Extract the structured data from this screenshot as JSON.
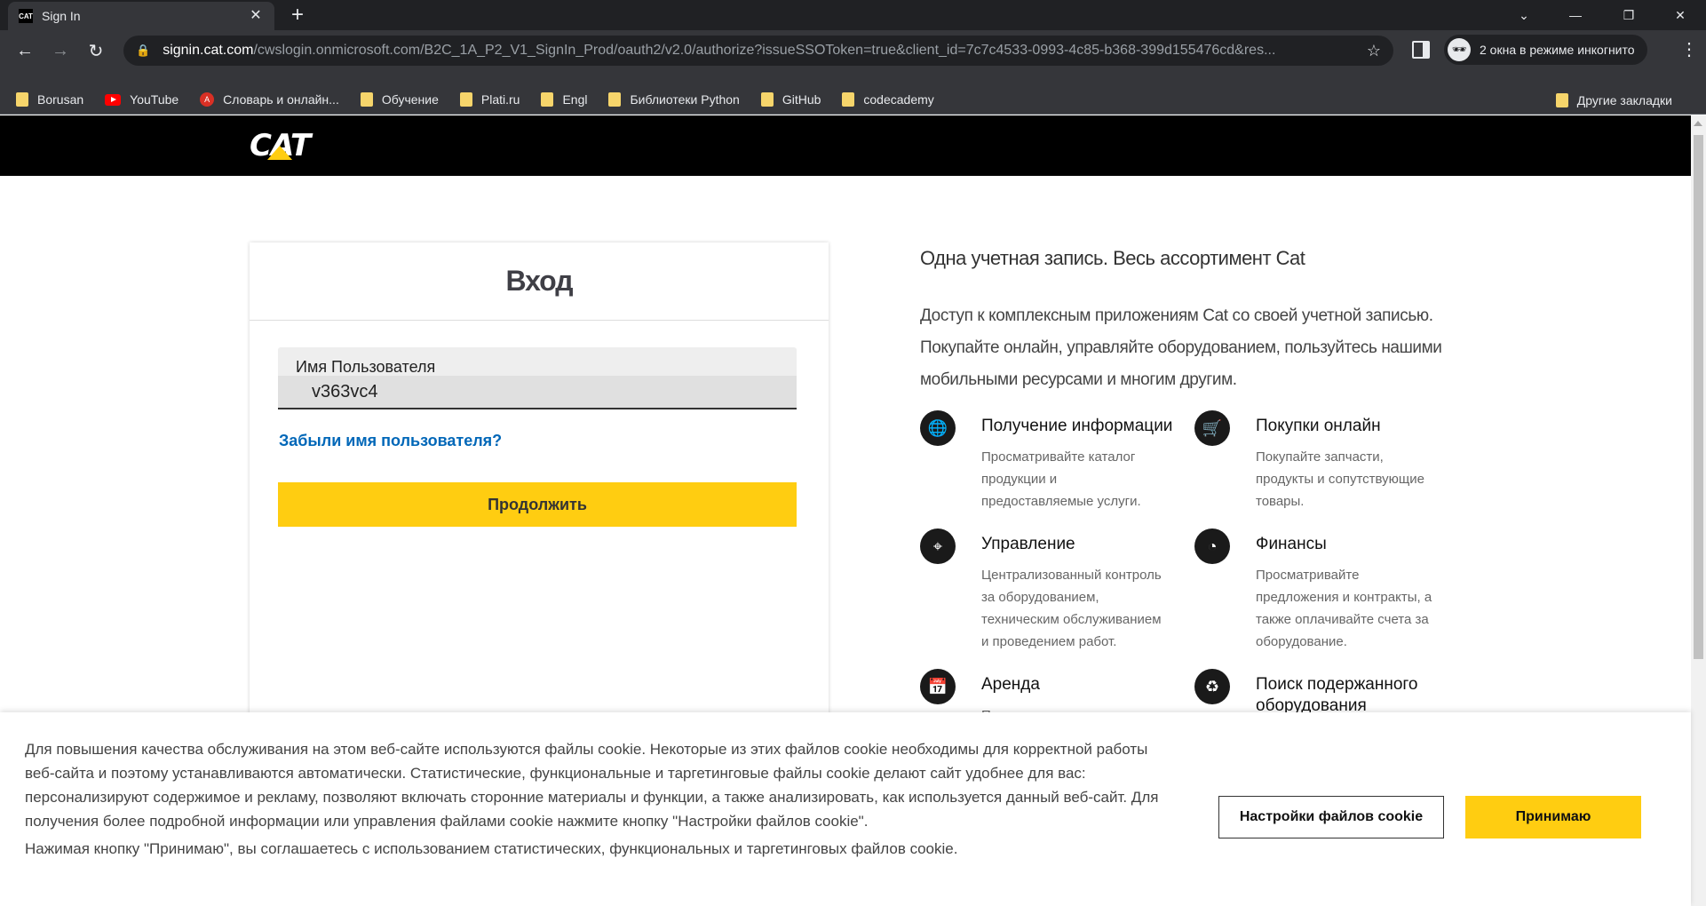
{
  "browser": {
    "tab_title": "Sign In",
    "favicon_text": "CAT",
    "url_host": "signin.cat.com",
    "url_path": "/cwslogin.onmicrosoft.com/B2C_1A_P2_V1_SignIn_Prod/oauth2/v2.0/authorize?issueSSOToken=true&client_id=7c7c4533-0993-4c85-b368-399d155476cd&res...",
    "incognito_label": "2 окна в режиме инкогнито",
    "bookmarks": [
      "Borusan",
      "YouTube",
      "Словарь и онлайн...",
      "Обучение",
      "Plati.ru",
      "Engl",
      "Библиотеки Python",
      "GitHub",
      "codecademy"
    ],
    "other_bookmarks": "Другие закладки"
  },
  "header": {
    "logo_text": "CAT",
    "brand_color": "#ffcd11"
  },
  "login": {
    "title": "Вход",
    "username_label": "Имя Пользователя",
    "username_value": "v363vc4",
    "forgot_link": "Забыли имя пользователя?",
    "continue_button": "Продолжить"
  },
  "promo": {
    "title": "Одна учетная запись. Весь ассортимент Cat",
    "text": "Доступ к комплексным приложениям Cat со своей учетной записью. Покупайте онлайн, управляйте оборудованием, пользуйтесь нашими мобильными ресурсами и многим другим.",
    "features": [
      {
        "icon": "globe-icon",
        "title": "Получение информации",
        "desc": "Просматривайте каталог продукции и предоставляемые услуги."
      },
      {
        "icon": "cart-icon",
        "title": "Покупки онлайн",
        "desc": "Покупайте запчасти, продукты и сопутствующие товары."
      },
      {
        "icon": "location-icon",
        "title": "Управление",
        "desc": "Централизованный контроль за оборудованием, техническим обслуживанием и проведением работ."
      },
      {
        "icon": "pie-chart-icon",
        "title": "Финансы",
        "desc": "Просматривайте предложения и контракты, а также оплачивайте счета за оборудование."
      },
      {
        "icon": "calendar-clock-icon",
        "title": "Аренда",
        "desc": "П..."
      },
      {
        "icon": "recycle-icon",
        "title": "Поиск подержанного оборудования",
        "desc": ""
      }
    ]
  },
  "cookie": {
    "text": "Для повышения качества обслуживания на этом веб-сайте используются файлы cookie. Некоторые из этих файлов cookie необходимы для корректной работы веб-сайта и поэтому устанавливаются автоматически. Статистические, функциональные и таргетинговые файлы cookie делают сайт удобнее для вас: персонализируют содержимое и рекламу, позволяют включать сторонние материалы и функции, а также анализировать, как используется данный веб-сайт. Для получения более подробной информации или управления файлами cookie нажмите кнопку \"Настройки файлов cookie\".",
    "consent_text": "Нажимая кнопку \"Принимаю\", вы соглашаетесь с использованием статистических, функциональных и таргетинговых файлов cookie.",
    "settings_button": "Настройки файлов cookie",
    "accept_button": "Принимаю"
  }
}
